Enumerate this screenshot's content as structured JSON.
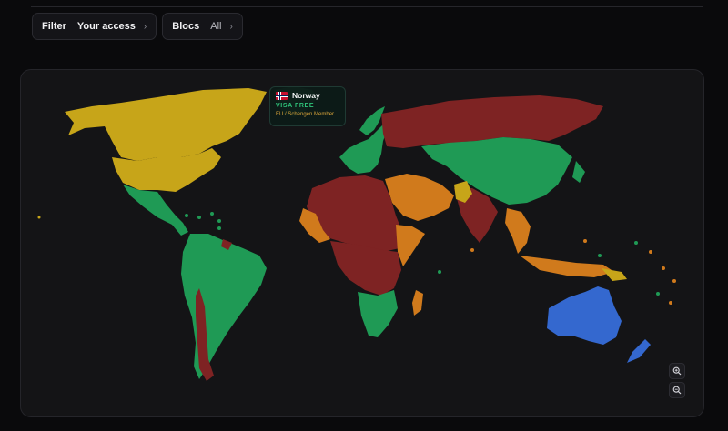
{
  "filters": {
    "filter": {
      "label": "Filter",
      "value": "Your access"
    },
    "blocs": {
      "label": "Blocs",
      "value": "All"
    }
  },
  "tooltip": {
    "country": "Norway",
    "status": "VISA FREE",
    "bloc": "EU / Schengen Member"
  },
  "colors": {
    "visa_free": "#1f9a55",
    "visa_on_arrival": "#d07a1c",
    "e_visa": "#c7a519",
    "visa_required": "#7e2323",
    "home": "#3468cf",
    "background": "#141416"
  },
  "icons": {
    "chevron": "chevron-right-icon",
    "zoom_in": "zoom-in-icon",
    "zoom_out": "zoom-out-icon",
    "flag": "norway-flag-icon"
  }
}
